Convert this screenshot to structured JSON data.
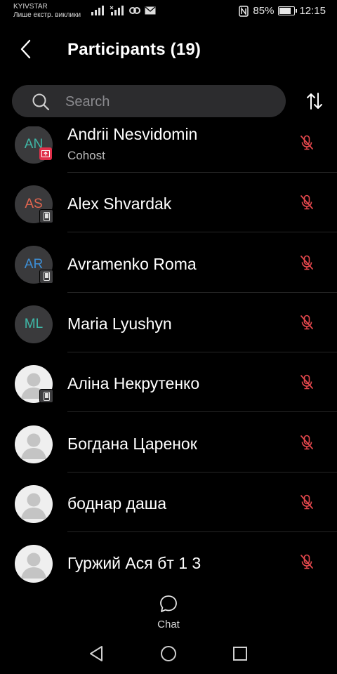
{
  "status_bar": {
    "carrier": "KYIVSTAR",
    "carrier_sub": "Лише екстр. виклики",
    "battery_percent": "85%",
    "battery_level": 0.85,
    "time": "12:15"
  },
  "header": {
    "title": "Participants (19)"
  },
  "search": {
    "placeholder": "Search"
  },
  "participants": [
    {
      "initials": "AN",
      "initials_color": "#3fb8a8",
      "name": "Andrii Nesvidomin",
      "role": "Cohost",
      "avatar": "initials",
      "badge": "cohost",
      "muted": true
    },
    {
      "initials": "AS",
      "initials_color": "#e0654f",
      "name": "Alex Shvardak",
      "role": "",
      "avatar": "initials",
      "badge": "phone",
      "muted": true
    },
    {
      "initials": "AR",
      "initials_color": "#3d8fd6",
      "name": "Avramenko Roma",
      "role": "",
      "avatar": "initials",
      "badge": "phone",
      "muted": true
    },
    {
      "initials": "ML",
      "initials_color": "#3fb8a8",
      "name": "Maria Lyushyn",
      "role": "",
      "avatar": "initials",
      "badge": "",
      "muted": true
    },
    {
      "initials": "",
      "initials_color": "",
      "name": "Аліна Некрутенко",
      "role": "",
      "avatar": "photo",
      "badge": "phone",
      "muted": true
    },
    {
      "initials": "",
      "initials_color": "",
      "name": "Богдана Царенок",
      "role": "",
      "avatar": "photo",
      "badge": "",
      "muted": true
    },
    {
      "initials": "",
      "initials_color": "",
      "name": "боднар даша",
      "role": "",
      "avatar": "photo",
      "badge": "",
      "muted": true
    },
    {
      "initials": "",
      "initials_color": "",
      "name": "Гуржий Ася бт 1 3",
      "role": "",
      "avatar": "photo",
      "badge": "",
      "muted": true
    }
  ],
  "bottom": {
    "chat_label": "Chat"
  },
  "colors": {
    "muted_icon": "#e5484d",
    "background": "#000000",
    "search_bg": "#2c2c2e"
  },
  "icons": {
    "back": "chevron-left-icon",
    "search": "search-icon",
    "sort": "sort-arrows-icon",
    "mute": "mic-off-icon",
    "chat": "chat-bubble-icon"
  }
}
